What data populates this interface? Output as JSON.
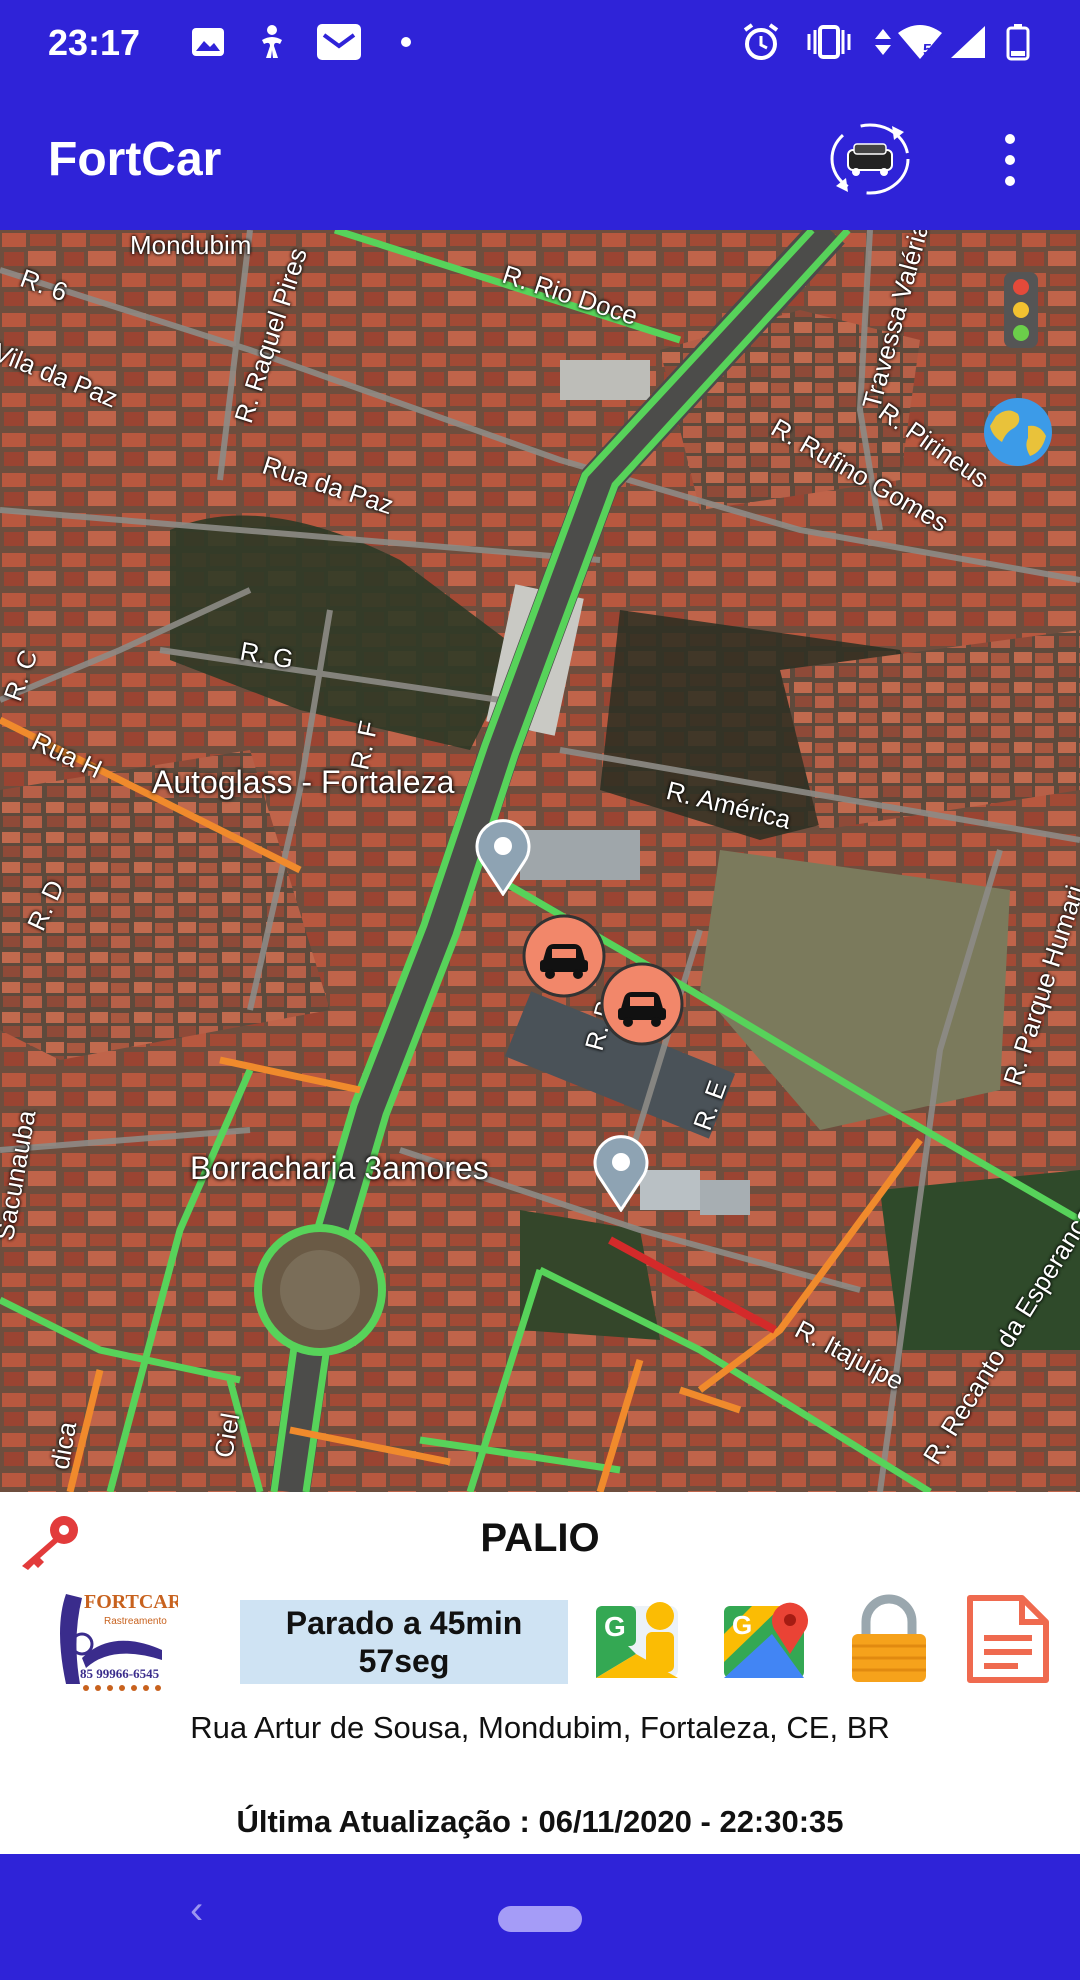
{
  "status_bar": {
    "time": "23:17",
    "network_badge": "5",
    "left_icons": [
      "image-notification-icon",
      "accessibility-notification-icon",
      "email-notification-icon",
      "dot-icon"
    ],
    "right_icons": [
      "alarm-icon",
      "vibrate-icon",
      "data-arrows-icon",
      "wifi-icon",
      "cell-signal-icon",
      "battery-icon"
    ]
  },
  "app_bar": {
    "title": "FortCar",
    "actions": [
      "refresh-vehicle-icon",
      "more-vert-icon"
    ]
  },
  "map": {
    "street_labels": [
      "Mondubim",
      "R. 6",
      "Vila da Paz",
      "R. Raquel Pires",
      "R. Rio Doce",
      "Travessa Valéria",
      "R. Pirineus",
      "R. Rufino Gomes",
      "Rua da Paz",
      "R. G",
      "R. C",
      "R. F",
      "Rua H",
      "R. América",
      "R. D",
      "R. B",
      "R. E",
      "R. Parque Humari",
      "Sacunauba",
      "R. Itajuípe",
      "R. Recanto da Esperança",
      "Ciel",
      "dica"
    ],
    "places": [
      "Autoglass - Fortaleza",
      "Borracharia 3amores"
    ],
    "controls": [
      "traffic-light-icon",
      "globe-icon"
    ],
    "markers": [
      "car-marker",
      "car-marker"
    ]
  },
  "vehicle": {
    "name": "PALIO",
    "status_line1": "Parado a 45min",
    "status_line2": "57seg",
    "address": "Rua Artur de Sousa, Mondubim, Fortaleza, CE, BR",
    "last_update": "Última Atualização : 06/11/2020 - 22:30:35",
    "logo_text": "FORTCAR",
    "logo_sub": "Rastreamento",
    "logo_phone": "85 99966-6545"
  },
  "colors": {
    "primary": "#2f23d8",
    "status_box": "#cfe3f3",
    "key_red": "#e23b3b",
    "marker_orange": "#f2876a",
    "traffic_green": "#57d35a",
    "traffic_orange": "#f08a2c",
    "traffic_red": "#d42a2a"
  }
}
